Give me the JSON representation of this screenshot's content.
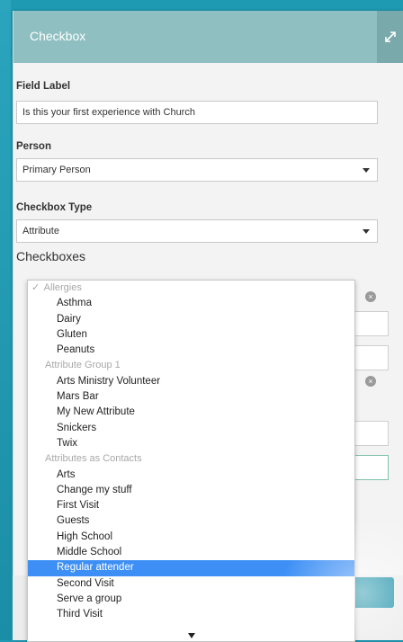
{
  "panel": {
    "title": "Checkbox",
    "expand_icon": "expand-arrows-icon"
  },
  "field_label": {
    "label": "Field Label",
    "value": "Is this your first experience with Church"
  },
  "person": {
    "label": "Person",
    "value": "Primary Person"
  },
  "checkbox_type": {
    "label": "Checkbox Type",
    "value": "Attribute"
  },
  "checkboxes": {
    "title": "Checkboxes"
  },
  "dropdown": {
    "group_allergies": "Allergies",
    "allergies": [
      "Asthma",
      "Dairy",
      "Gluten",
      "Peanuts"
    ],
    "group_attr1": "Attribute Group 1",
    "attr1": [
      "Arts Ministry Volunteer",
      "Mars Bar",
      "My New Attribute",
      "Snickers",
      "Twix"
    ],
    "group_contacts": "Attributes as Contacts",
    "contacts": [
      "Arts",
      "Change my stuff",
      "First Visit",
      "Guests",
      "High School",
      "Middle School",
      "Regular attender",
      "Second Visit",
      "Serve a group",
      "Third Visit"
    ],
    "selected": "Regular attender",
    "check_mark": "✓"
  },
  "colors": {
    "header": "#8fbfc1",
    "accent": "#1e9bb3",
    "selection": "#3d8ff5"
  }
}
